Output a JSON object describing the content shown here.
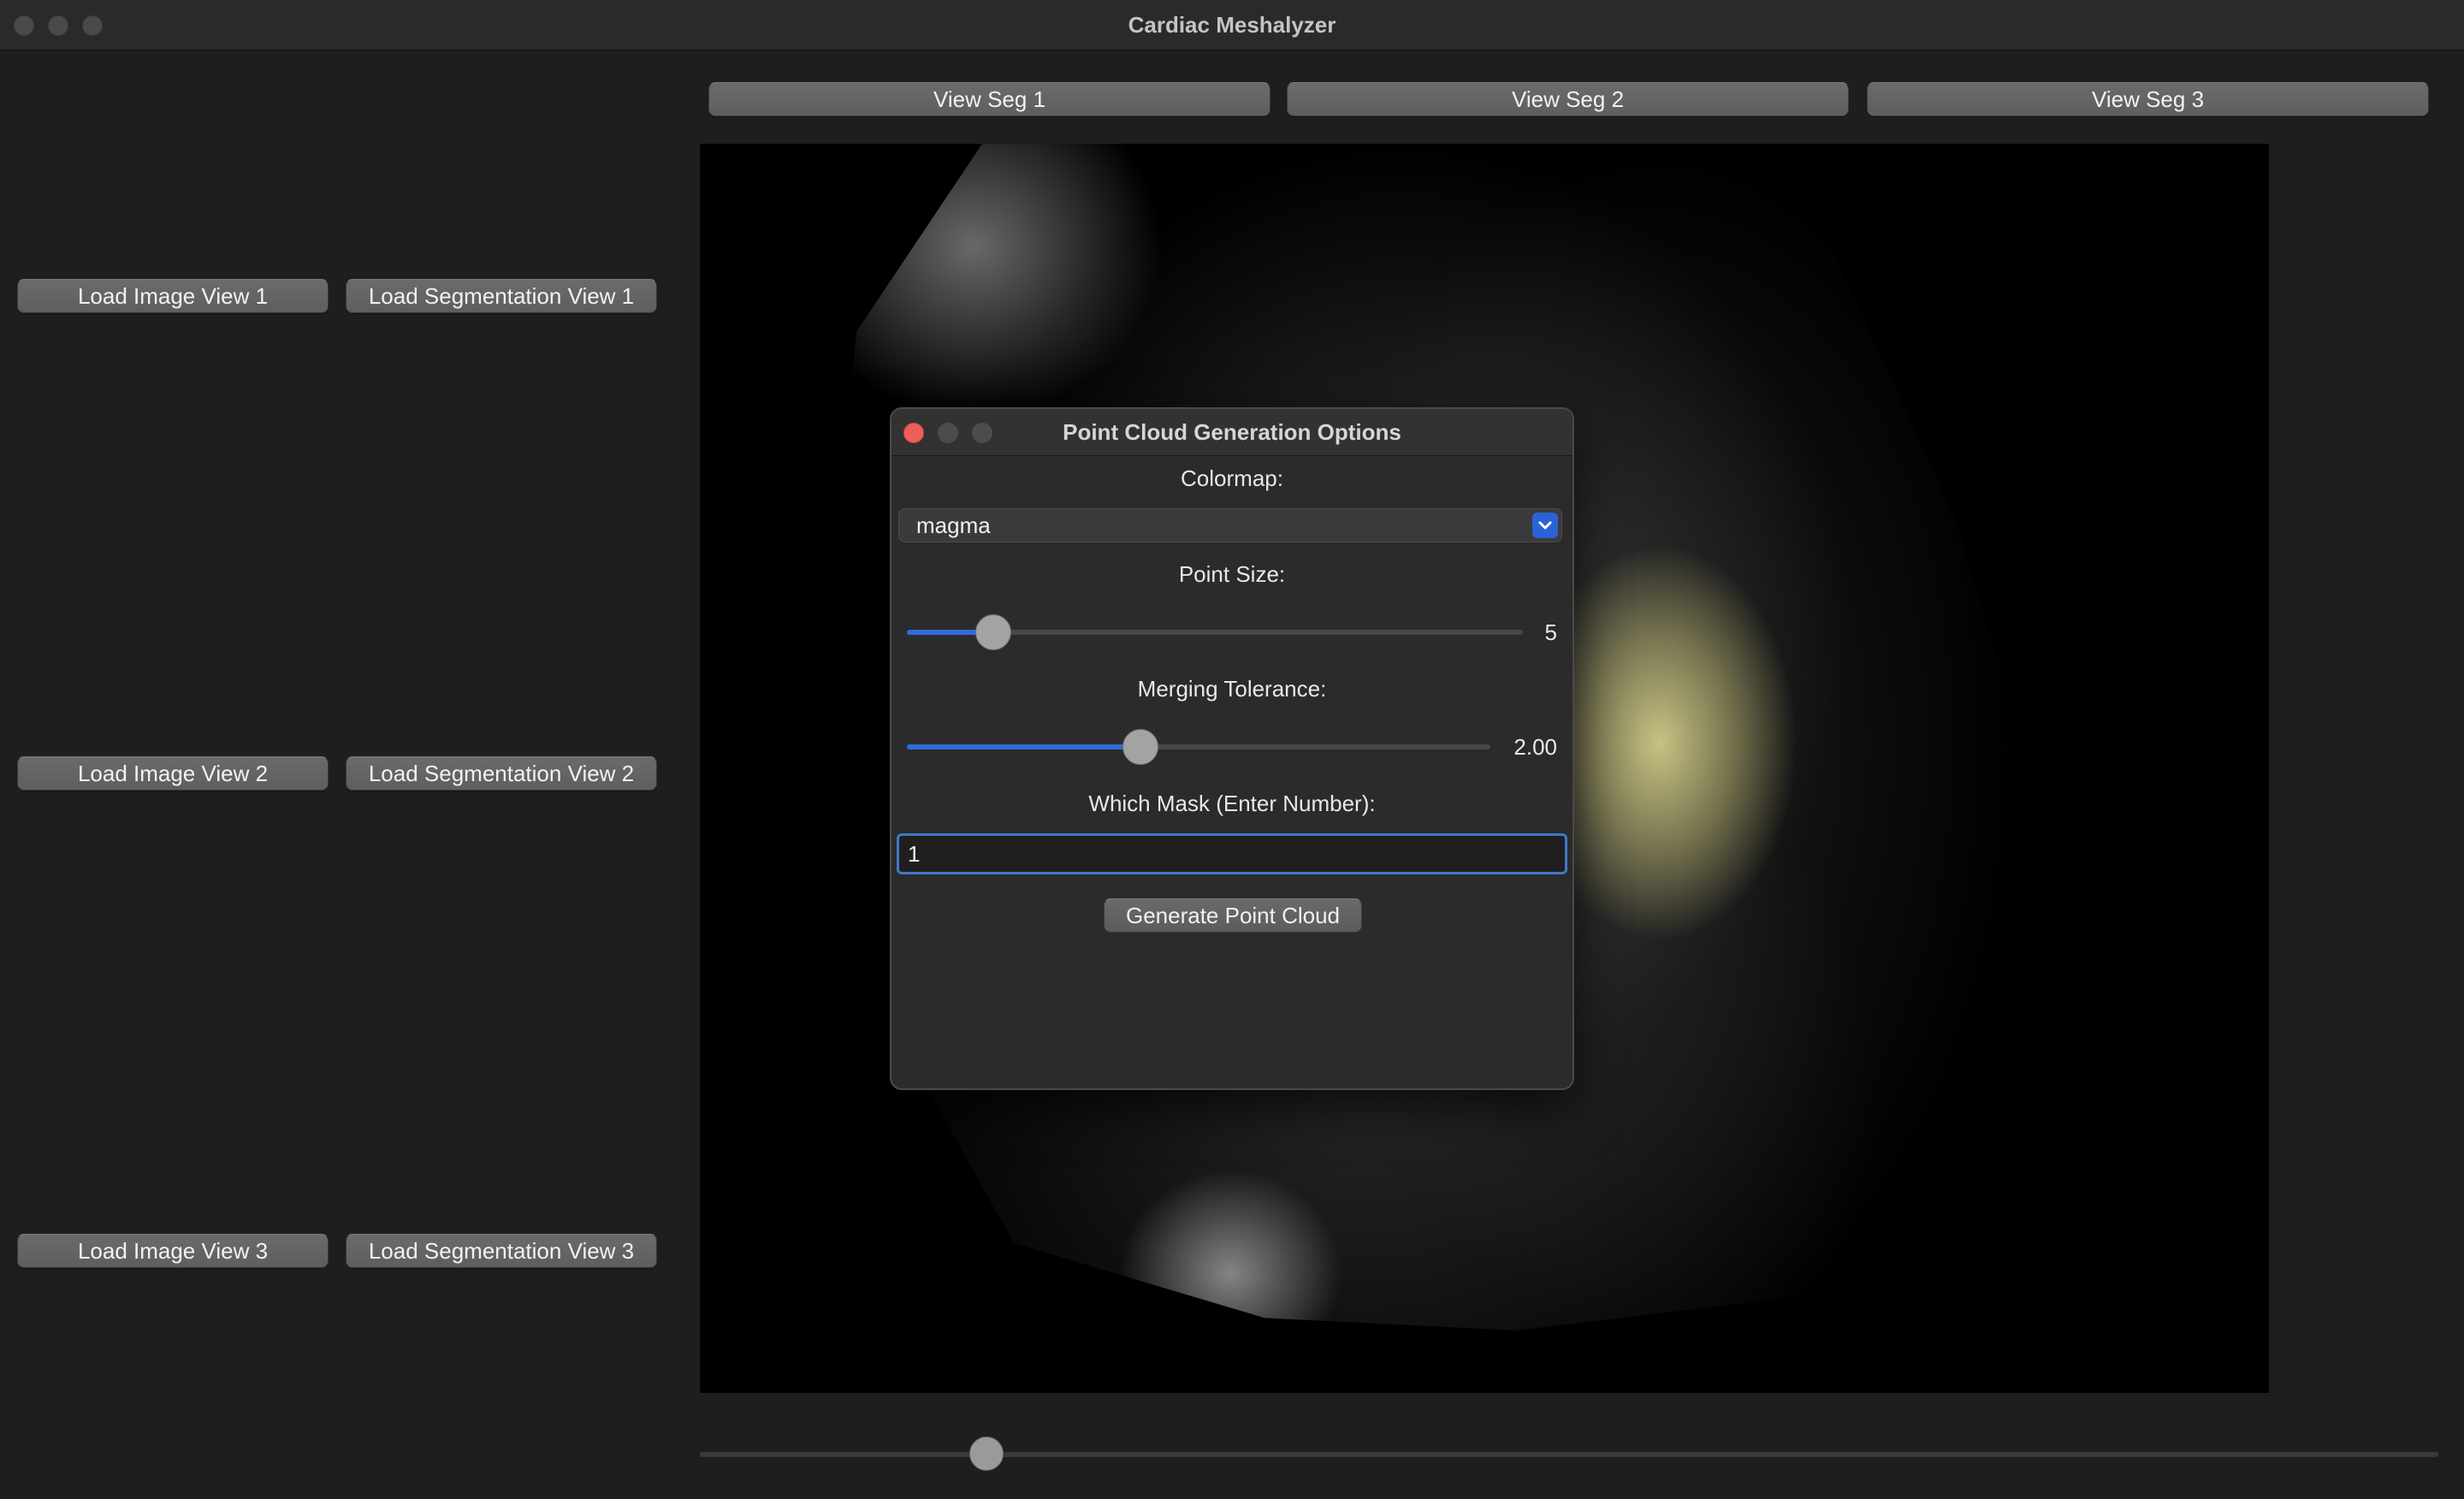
{
  "window": {
    "title": "Cardiac Meshalyzer"
  },
  "top_buttons": [
    {
      "label": "View Seg 1"
    },
    {
      "label": "View Seg 2"
    },
    {
      "label": "View Seg 3"
    }
  ],
  "left_panel": {
    "rows": [
      {
        "load_image": "Load Image View 1",
        "load_segmentation": "Load Segmentation View 1"
      },
      {
        "load_image": "Load Image View 2",
        "load_segmentation": "Load Segmentation View 2"
      },
      {
        "load_image": "Load Image View 3",
        "load_segmentation": "Load Segmentation View 3"
      }
    ]
  },
  "viewer": {
    "description_icon": "mri-slice-image",
    "segmentation_overlay_color": "#d8d58a"
  },
  "slice_slider": {
    "value_fraction": 0.165
  },
  "dialog": {
    "title": "Point Cloud Generation Options",
    "colormap_label": "Colormap:",
    "colormap_value": "magma",
    "point_size_label": "Point Size:",
    "point_size_value": "5",
    "point_size_fraction": 0.14,
    "merging_tolerance_label": "Merging Tolerance:",
    "merging_tolerance_value": "2.00",
    "merging_tolerance_fraction": 0.4,
    "mask_label": "Which Mask (Enter Number):",
    "mask_value": "1",
    "generate_button": "Generate Point Cloud"
  },
  "colors": {
    "accent": "#2d6bdf",
    "close_red": "#ee5f57",
    "background": "#1e1e1e"
  }
}
